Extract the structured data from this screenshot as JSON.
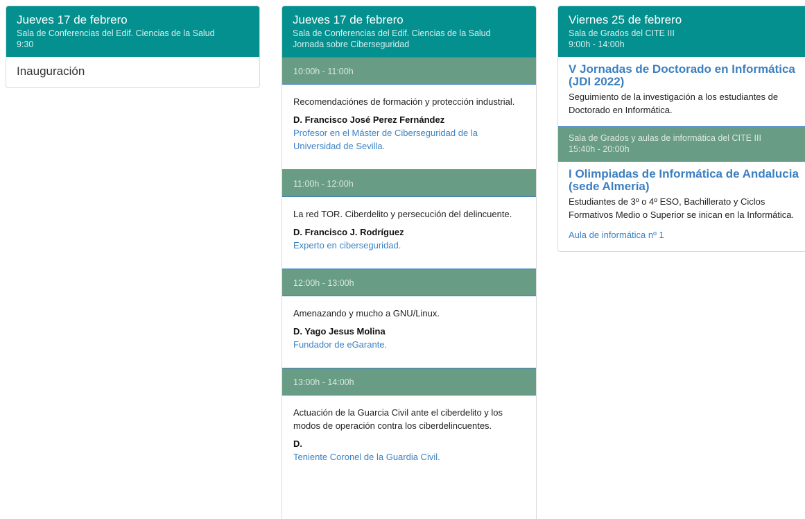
{
  "col1": {
    "day": "Jueves 17 de febrero",
    "place": "Sala de Conferencias del Edif. Ciencias de la Salud",
    "time": "9:30",
    "title": "Inauguración"
  },
  "col2": {
    "day": "Jueves 17 de febrero",
    "place": "Sala de Conferencias del Edif. Ciencias de la Salud",
    "subtitle": "Jornada sobre Ciberseguridad",
    "slots": [
      {
        "time": "10:00h - 11:00h",
        "topic": "Recomendaciónes de formación y protección industrial.",
        "speaker": "D. Francisco José Perez Fernández",
        "role": "Profesor en el Máster de Ciberseguridad de la Universidad de Sevilla."
      },
      {
        "time": "11:00h - 12:00h",
        "topic": "La red TOR. Ciberdelito y persecución del delincuente.",
        "speaker": "D. Francisco J. Rodríguez",
        "role": "Experto en ciberseguridad."
      },
      {
        "time": "12:00h - 13:00h",
        "topic": "Amenazando y mucho a GNU/Linux.",
        "speaker": "D. Yago Jesus Molina",
        "role": "Fundador de eGarante."
      },
      {
        "time": "13:00h - 14:00h",
        "topic": "Actuación de la Guarcia Civil ante el ciberdelito y los modos de operación contra los ciberdelincuentes.",
        "speaker": "D.",
        "role": "Teniente Coronel de la Guardia Civil."
      }
    ]
  },
  "col3": {
    "day": "Viernes 25 de febrero",
    "place": "Sala de Grados del CITE III",
    "time": "9:00h - 14:00h",
    "event1": {
      "title": "V Jornadas de Doctorado en Informática (JDI 2022)",
      "desc": "Seguimiento de la investigación a los estudiantes de Doctorado en Informática."
    },
    "slot2": {
      "place": "Sala de Grados y aulas de informática del CITE III",
      "time": "15:40h - 20:00h"
    },
    "event2": {
      "title": "I Olimpiadas de Informática de Andalucia (sede Almería)",
      "desc": "Estudiantes de 3º o 4º ESO, Bachillerato y Ciclos Formativos Medio o Superior se inican en la Informática.",
      "link": "Aula de informática nº 1"
    }
  }
}
